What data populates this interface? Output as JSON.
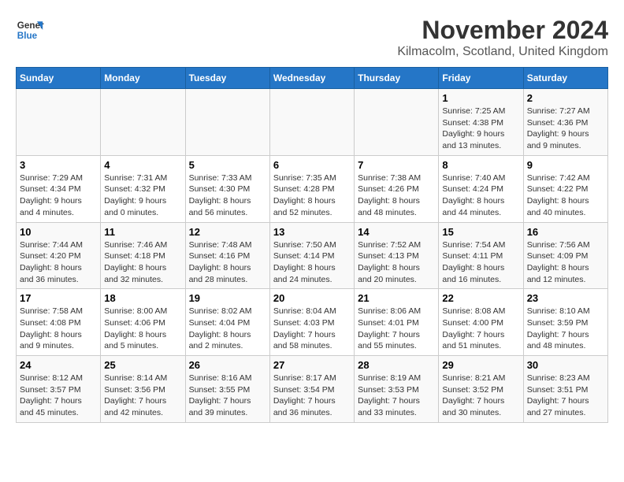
{
  "logo": {
    "line1": "General",
    "line2": "Blue"
  },
  "title": "November 2024",
  "location": "Kilmacolm, Scotland, United Kingdom",
  "weekdays": [
    "Sunday",
    "Monday",
    "Tuesday",
    "Wednesday",
    "Thursday",
    "Friday",
    "Saturday"
  ],
  "weeks": [
    [
      {
        "day": "",
        "info": ""
      },
      {
        "day": "",
        "info": ""
      },
      {
        "day": "",
        "info": ""
      },
      {
        "day": "",
        "info": ""
      },
      {
        "day": "",
        "info": ""
      },
      {
        "day": "1",
        "info": "Sunrise: 7:25 AM\nSunset: 4:38 PM\nDaylight: 9 hours and 13 minutes."
      },
      {
        "day": "2",
        "info": "Sunrise: 7:27 AM\nSunset: 4:36 PM\nDaylight: 9 hours and 9 minutes."
      }
    ],
    [
      {
        "day": "3",
        "info": "Sunrise: 7:29 AM\nSunset: 4:34 PM\nDaylight: 9 hours and 4 minutes."
      },
      {
        "day": "4",
        "info": "Sunrise: 7:31 AM\nSunset: 4:32 PM\nDaylight: 9 hours and 0 minutes."
      },
      {
        "day": "5",
        "info": "Sunrise: 7:33 AM\nSunset: 4:30 PM\nDaylight: 8 hours and 56 minutes."
      },
      {
        "day": "6",
        "info": "Sunrise: 7:35 AM\nSunset: 4:28 PM\nDaylight: 8 hours and 52 minutes."
      },
      {
        "day": "7",
        "info": "Sunrise: 7:38 AM\nSunset: 4:26 PM\nDaylight: 8 hours and 48 minutes."
      },
      {
        "day": "8",
        "info": "Sunrise: 7:40 AM\nSunset: 4:24 PM\nDaylight: 8 hours and 44 minutes."
      },
      {
        "day": "9",
        "info": "Sunrise: 7:42 AM\nSunset: 4:22 PM\nDaylight: 8 hours and 40 minutes."
      }
    ],
    [
      {
        "day": "10",
        "info": "Sunrise: 7:44 AM\nSunset: 4:20 PM\nDaylight: 8 hours and 36 minutes."
      },
      {
        "day": "11",
        "info": "Sunrise: 7:46 AM\nSunset: 4:18 PM\nDaylight: 8 hours and 32 minutes."
      },
      {
        "day": "12",
        "info": "Sunrise: 7:48 AM\nSunset: 4:16 PM\nDaylight: 8 hours and 28 minutes."
      },
      {
        "day": "13",
        "info": "Sunrise: 7:50 AM\nSunset: 4:14 PM\nDaylight: 8 hours and 24 minutes."
      },
      {
        "day": "14",
        "info": "Sunrise: 7:52 AM\nSunset: 4:13 PM\nDaylight: 8 hours and 20 minutes."
      },
      {
        "day": "15",
        "info": "Sunrise: 7:54 AM\nSunset: 4:11 PM\nDaylight: 8 hours and 16 minutes."
      },
      {
        "day": "16",
        "info": "Sunrise: 7:56 AM\nSunset: 4:09 PM\nDaylight: 8 hours and 12 minutes."
      }
    ],
    [
      {
        "day": "17",
        "info": "Sunrise: 7:58 AM\nSunset: 4:08 PM\nDaylight: 8 hours and 9 minutes."
      },
      {
        "day": "18",
        "info": "Sunrise: 8:00 AM\nSunset: 4:06 PM\nDaylight: 8 hours and 5 minutes."
      },
      {
        "day": "19",
        "info": "Sunrise: 8:02 AM\nSunset: 4:04 PM\nDaylight: 8 hours and 2 minutes."
      },
      {
        "day": "20",
        "info": "Sunrise: 8:04 AM\nSunset: 4:03 PM\nDaylight: 7 hours and 58 minutes."
      },
      {
        "day": "21",
        "info": "Sunrise: 8:06 AM\nSunset: 4:01 PM\nDaylight: 7 hours and 55 minutes."
      },
      {
        "day": "22",
        "info": "Sunrise: 8:08 AM\nSunset: 4:00 PM\nDaylight: 7 hours and 51 minutes."
      },
      {
        "day": "23",
        "info": "Sunrise: 8:10 AM\nSunset: 3:59 PM\nDaylight: 7 hours and 48 minutes."
      }
    ],
    [
      {
        "day": "24",
        "info": "Sunrise: 8:12 AM\nSunset: 3:57 PM\nDaylight: 7 hours and 45 minutes."
      },
      {
        "day": "25",
        "info": "Sunrise: 8:14 AM\nSunset: 3:56 PM\nDaylight: 7 hours and 42 minutes."
      },
      {
        "day": "26",
        "info": "Sunrise: 8:16 AM\nSunset: 3:55 PM\nDaylight: 7 hours and 39 minutes."
      },
      {
        "day": "27",
        "info": "Sunrise: 8:17 AM\nSunset: 3:54 PM\nDaylight: 7 hours and 36 minutes."
      },
      {
        "day": "28",
        "info": "Sunrise: 8:19 AM\nSunset: 3:53 PM\nDaylight: 7 hours and 33 minutes."
      },
      {
        "day": "29",
        "info": "Sunrise: 8:21 AM\nSunset: 3:52 PM\nDaylight: 7 hours and 30 minutes."
      },
      {
        "day": "30",
        "info": "Sunrise: 8:23 AM\nSunset: 3:51 PM\nDaylight: 7 hours and 27 minutes."
      }
    ]
  ]
}
